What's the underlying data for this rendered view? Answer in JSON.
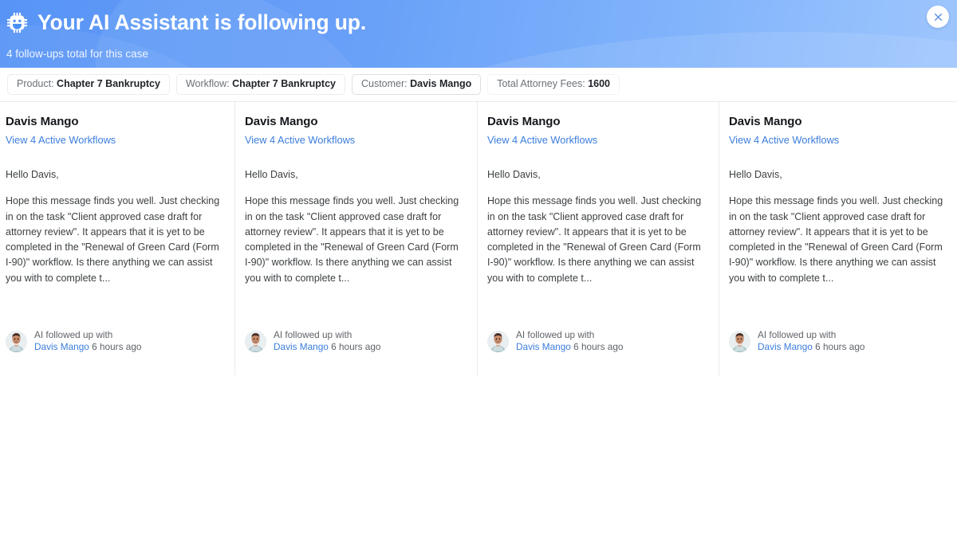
{
  "header": {
    "icon": "smart-toy-icon",
    "title": "Your AI Assistant is following up.",
    "subtitle": "4 follow-ups total for this case",
    "close_icon": "close-icon",
    "accent_color": "#3b82f6",
    "gradient_end_color": "#8dbcfd"
  },
  "meta_bar": {
    "chips": [
      {
        "label": "Product:",
        "value": "Chapter 7 Bankruptcy"
      },
      {
        "label": "Workflow:",
        "value": "Chapter 7 Bankruptcy"
      },
      {
        "label": "Customer:",
        "value": "Davis Mango"
      },
      {
        "label": "Total Attorney Fees:",
        "value": "1600"
      }
    ]
  },
  "cards": [
    {
      "name": "Davis Mango",
      "link": "View 4 Active Workflows",
      "greeting": "Hello Davis,",
      "body": "Hope this message finds you well. Just checking in on the task \"Client approved case draft for attorney review\". It appears that it is yet to be completed in the \"Renewal of Green Card (Form I-90)\" workflow. Is there anything we can assist you with to complete t...",
      "footer_prefix": "AI followed up with",
      "footer_who": "Davis Mango",
      "footer_time": "6 hours ago",
      "avatar": "user-photo-avatar"
    },
    {
      "name": "Davis Mango",
      "link": "View 4 Active Workflows",
      "greeting": "Hello Davis,",
      "body": "Hope this message finds you well. Just checking in on the task \"Client approved case draft for attorney review\". It appears that it is yet to be completed in the \"Renewal of Green Card (Form I-90)\" workflow. Is there anything we can assist you with to complete t...",
      "footer_prefix": "AI followed up with",
      "footer_who": "Davis Mango",
      "footer_time": "6 hours ago",
      "avatar": "user-photo-avatar"
    },
    {
      "name": "Davis Mango",
      "link": "View 4 Active Workflows",
      "greeting": "Hello Davis,",
      "body": "Hope this message finds you well. Just checking in on the task \"Client approved case draft for attorney review\". It appears that it is yet to be completed in the \"Renewal of Green Card (Form I-90)\" workflow. Is there anything we can assist you with to complete t...",
      "footer_prefix": "AI followed up with",
      "footer_who": "Davis Mango",
      "footer_time": "6 hours ago",
      "avatar": "user-photo-avatar"
    },
    {
      "name": "Davis Mango",
      "link": "View 4 Active Workflows",
      "greeting": "Hello Davis,",
      "body": "Hope this message finds you well. Just checking in on the task \"Client approved case draft for attorney review\". It appears that it is yet to be completed in the \"Renewal of Green Card (Form I-90)\" workflow. Is there anything we can assist you with to complete t...",
      "footer_prefix": "AI followed up with",
      "footer_who": "Davis Mango",
      "footer_time": "6 hours ago",
      "avatar": "user-photo-avatar"
    }
  ]
}
